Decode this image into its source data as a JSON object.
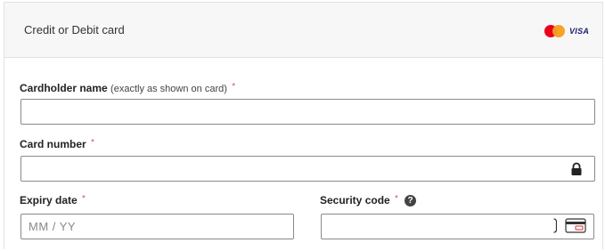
{
  "header": {
    "title": "Credit or Debit card",
    "brand_logos": [
      "mastercard-logo",
      "visa-logo"
    ],
    "visa_text": "VISA"
  },
  "form": {
    "cardholder": {
      "label": "Cardholder name",
      "note": "(exactly as shown on card)",
      "required_mark": "*",
      "value": ""
    },
    "card_number": {
      "label": "Card number",
      "required_mark": "*",
      "value": "",
      "icon": "lock-icon"
    },
    "expiry": {
      "label": "Expiry date",
      "required_mark": "*",
      "placeholder": "MM / YY",
      "value": ""
    },
    "security_code": {
      "label": "Security code",
      "required_mark": "*",
      "help_icon": "question-icon",
      "help_text": "?",
      "value": "",
      "icon": "card-cvv-icon"
    }
  },
  "colors": {
    "required": "#d9534f",
    "input_border": "#8a8a8a",
    "header_bg": "#f7f7f7",
    "mastercard_red": "#eb001b",
    "mastercard_yellow": "#f79e1b",
    "visa_blue": "#1a1f71"
  }
}
